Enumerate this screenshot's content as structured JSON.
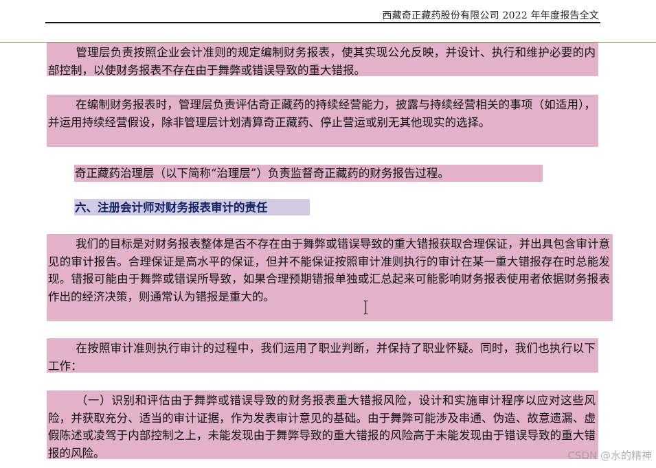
{
  "header": {
    "title": "西藏奇正藏药股份有限公司 2022 年年度报告全文"
  },
  "paragraphs": {
    "p1": "管理层负责按照企业会计准则的规定编制财务报表，使其实现公允反映，并设计、执行和维护必要的内部控制，以使财务报表不存在由于舞弊或错误导致的重大错报。",
    "p2": "在编制财务报表时，管理层负责评估奇正藏药的持续经营能力，披露与持续经营相关的事项（如适用），并运用持续经营假设，除非管理层计划清算奇正藏药、停止营运或别无其他现实的选择。",
    "p3": "奇正藏药治理层（以下简称“治理层”）负责监督奇正藏药的财务报告过程。",
    "section_heading": "六、注册会计师对财务报表审计的责任",
    "p4": "我们的目标是对财务报表整体是否不存在由于舞弊或错误导致的重大错报获取合理保证，并出具包含审计意见的审计报告。合理保证是高水平的保证，但并不能保证按照审计准则执行的审计在某一重大错报存在时总能发现。错报可能由于舞弊或错误所导致，如果合理预期错报单独或汇总起来可能影响财务报表使用者依据财务报表作出的经济决策，则通常认为错报是重大的。",
    "p5": "在按照审计准则执行审计的过程中，我们运用了职业判断，并保持了职业怀疑。同时，我们也执行以下工作：",
    "p6": "（一）识别和评估由于舞弊或错误导致的财务报表重大错报风险，设计和实施审计程序以应对这些风险，并获取充分、适当的审计证据，作为发表审计意见的基础。由于舞弊可能涉及串通、伪造、故意遗漏、虚假陈述或凌驾于内部控制之上，未能发现由于舞弊导致的重大错报的风险高于未能发现由于错误导致的重大错报的风险。"
  },
  "watermark": "CSDN @水的精神",
  "icons": {
    "cursor": "text-cursor-icon"
  },
  "colors": {
    "highlight": "#e2b2c8",
    "heading_highlight": "#d1cbe4",
    "heading_text": "#0c1f63",
    "margin_line": "#e45a5a"
  }
}
